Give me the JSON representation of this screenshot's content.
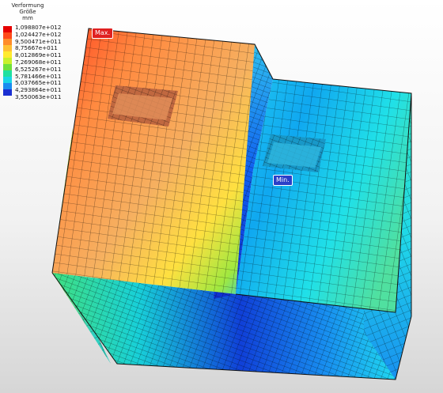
{
  "legend": {
    "title": "Verformung",
    "subtitle": "Größe",
    "unit": "mm",
    "values": [
      "1,098807e+012",
      "1,024427e+012",
      "9,500471e+011",
      "8,75667e+011",
      "8,012869e+011",
      "7,269068e+011",
      "6,525267e+011",
      "5,781466e+011",
      "5,037665e+011",
      "4,293864e+011",
      "3,550063e+011"
    ],
    "colors": [
      "#e60000",
      "#ff4a1a",
      "#ff8c2a",
      "#ffbf33",
      "#ffea2e",
      "#c8f02a",
      "#6fe13a",
      "#1fe0a0",
      "#19d6e6",
      "#1a8cf0",
      "#1a2fd2"
    ]
  },
  "markers": {
    "max": "Max.",
    "min": "Min."
  }
}
